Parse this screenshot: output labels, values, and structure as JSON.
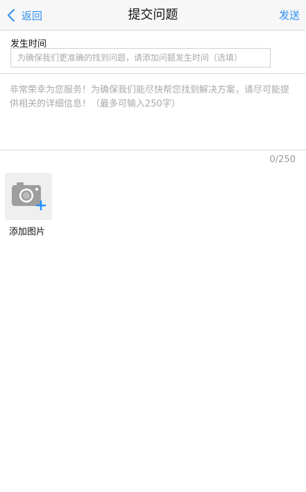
{
  "navbar": {
    "back_label": "返回",
    "title": "提交问题",
    "send_label": "发送"
  },
  "time_section": {
    "label": "发生时间",
    "placeholder": "为确保我们更准确的找到问题，请添加问题发生时间（选填）",
    "value": ""
  },
  "description": {
    "placeholder": "非常荣幸为您服务！为确保我们能尽快帮您找到解决方案，请尽可能提供相关的详细信息！（最多可输入250字）",
    "value": "",
    "counter": "0/250"
  },
  "attachment": {
    "label": "添加图片",
    "icon": "camera-add-icon"
  },
  "colors": {
    "accent": "#2f8ff0",
    "add_plus": "#1e90ff",
    "divider": "#d9d9d9",
    "placeholder": "#a9a9a9"
  }
}
